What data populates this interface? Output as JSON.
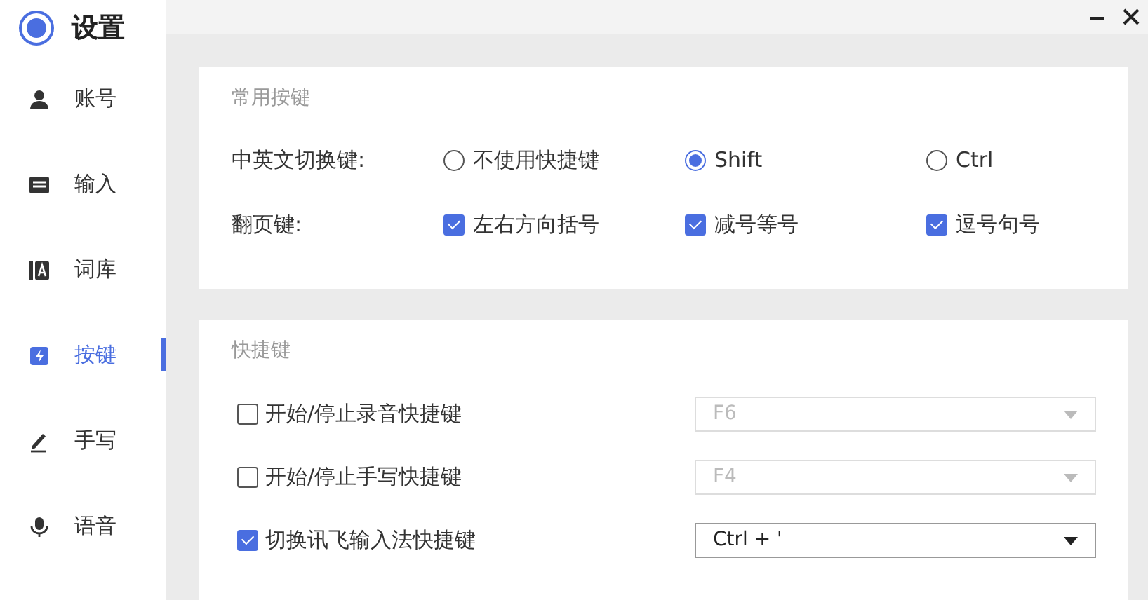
{
  "window": {
    "title": "设置"
  },
  "sidebar": {
    "items": [
      {
        "label": "账号",
        "selected": false
      },
      {
        "label": "输入",
        "selected": false
      },
      {
        "label": "词库",
        "selected": false
      },
      {
        "label": "按键",
        "selected": true
      },
      {
        "label": "手写",
        "selected": false
      },
      {
        "label": "语音",
        "selected": false
      }
    ]
  },
  "common_keys": {
    "title": "常用按键",
    "switch_row": {
      "label": "中英文切换键:",
      "options": [
        {
          "label": "不使用快捷键",
          "selected": false
        },
        {
          "label": "Shift",
          "selected": true
        },
        {
          "label": "Ctrl",
          "selected": false
        }
      ]
    },
    "page_row": {
      "label": "翻页键:",
      "options": [
        {
          "label": "左右方向括号",
          "checked": true
        },
        {
          "label": "减号等号",
          "checked": true
        },
        {
          "label": "逗号句号",
          "checked": true
        }
      ]
    }
  },
  "shortcuts": {
    "title": "快捷键",
    "rows": [
      {
        "label": "开始/停止录音快捷键",
        "checked": false,
        "value": "F6"
      },
      {
        "label": "开始/停止手写快捷键",
        "checked": false,
        "value": "F4"
      },
      {
        "label": "切换讯飞输入法快捷键",
        "checked": true,
        "value": "Ctrl + '"
      }
    ]
  }
}
